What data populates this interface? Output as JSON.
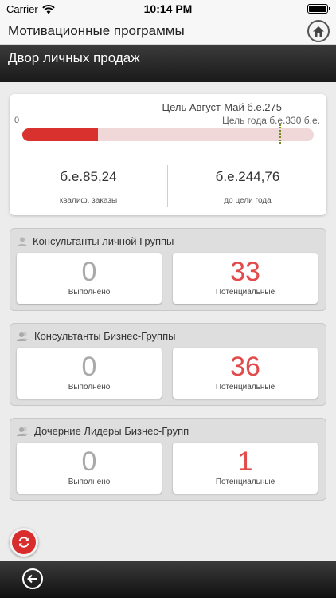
{
  "status_bar": {
    "carrier": "Carrier",
    "time": "10:14 PM"
  },
  "header": {
    "title": "Мотивационные программы",
    "home_icon": "home-icon"
  },
  "section": {
    "title": "Двор личных продаж"
  },
  "goal": {
    "goal_text": "Цель Август-Май  б.е.275",
    "year_goal_text": "Цель года   б.е.330 б.е.",
    "zero": "0",
    "progress_fraction": 0.26,
    "year_marker_fraction": 0.883,
    "progress_color": "#d9322e",
    "left_value": "б.е.85,24",
    "left_label": "квалиф. заказы",
    "right_value": "б.е.244,76",
    "right_label": "до цели года"
  },
  "groups": [
    {
      "title": "Консультанты личной Группы",
      "done": "0",
      "done_label": "Выполнено",
      "potential": "33",
      "potential_label": "Потенциальные"
    },
    {
      "title": "Консультанты Бизнес-Группы",
      "done": "0",
      "done_label": "Выполнено",
      "potential": "36",
      "potential_label": "Потенциальные"
    },
    {
      "title": "Дочерние Лидеры Бизнес-Групп",
      "done": "0",
      "done_label": "Выполнено",
      "potential": "1",
      "potential_label": "Потенциальные"
    }
  ],
  "colors": {
    "accent_red": "#e24b4b",
    "bar_dark": "#1a1a1a"
  }
}
